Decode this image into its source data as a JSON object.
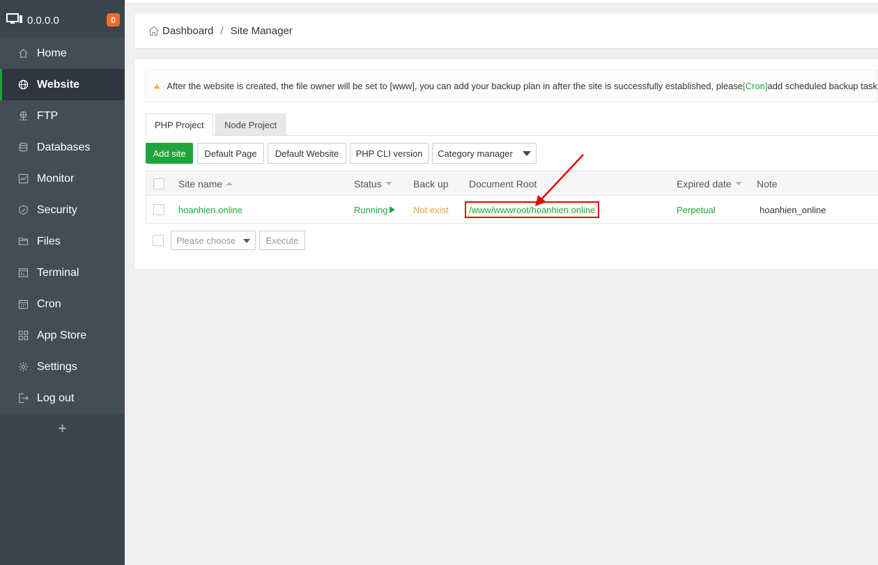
{
  "sidebar": {
    "server_ip": "0.0.0.0",
    "notification_count": "0",
    "items": [
      {
        "label": "Home",
        "icon": "home-icon"
      },
      {
        "label": "Website",
        "icon": "globe-icon",
        "active": true
      },
      {
        "label": "FTP",
        "icon": "ftp-icon"
      },
      {
        "label": "Databases",
        "icon": "database-icon"
      },
      {
        "label": "Monitor",
        "icon": "monitor-icon"
      },
      {
        "label": "Security",
        "icon": "shield-icon"
      },
      {
        "label": "Files",
        "icon": "folder-icon"
      },
      {
        "label": "Terminal",
        "icon": "terminal-icon"
      },
      {
        "label": "Cron",
        "icon": "calendar-icon"
      },
      {
        "label": "App Store",
        "icon": "grid-icon"
      },
      {
        "label": "Settings",
        "icon": "gear-icon"
      },
      {
        "label": "Log out",
        "icon": "logout-icon"
      }
    ],
    "add_label": "+"
  },
  "breadcrumb": {
    "home": "Dashboard",
    "separator": "/",
    "current": "Site Manager"
  },
  "alert": {
    "text_before": "After the website is created, the file owner will be set to [www], you can add your backup plan in after the site is successfully established, please",
    "cron_link": "[Cron]",
    "text_after": "add scheduled backup task"
  },
  "tabs": [
    "PHP Project",
    "Node Project"
  ],
  "toolbar": {
    "add_site": "Add site",
    "default_page": "Default Page",
    "default_website": "Default Website",
    "php_cli": "PHP CLI version",
    "category_manager": "Category manager"
  },
  "table": {
    "headers": {
      "site_name": "Site name",
      "status": "Status",
      "backup": "Back up",
      "document_root": "Document Root",
      "expired": "Expired date",
      "note": "Note"
    },
    "rows": [
      {
        "site_name": "hoanhien.online",
        "status": "Running",
        "backup": "Not exist",
        "document_root": "/www/wwwroot/hoanhien.online",
        "expired": "Perpetual",
        "note": "hoanhien_online"
      }
    ]
  },
  "batch": {
    "placeholder": "Please choose",
    "execute": "Execute"
  },
  "colors": {
    "sidebar_bg": "#3c444d",
    "accent_green": "#20a53a",
    "badge_orange": "#f7692b",
    "warning_orange": "#e6a23c",
    "highlight_red": "#e00000"
  }
}
